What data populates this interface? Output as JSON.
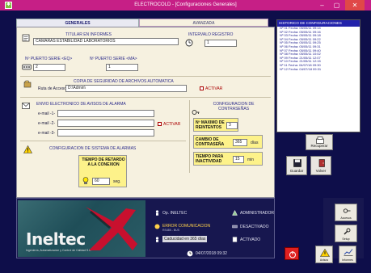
{
  "window": {
    "title": "ELECTROCOLD - [Configuraciones Generales]",
    "minimize": "–",
    "maximize": "▢",
    "close": "✕"
  },
  "tabs": [
    {
      "label": "GENERALES",
      "active": true
    },
    {
      "label": "AVANZADA",
      "active": false
    }
  ],
  "general": {
    "titular_label": "TITULAR EN INFORMES",
    "titular_value": "CAMARAS ESTABILIDAD LABORATORIOS",
    "intervalo_label": "INTERVALO REGISTRO",
    "intervalo_value": "1",
    "puerto_eq_label": "Nº PUERTO SERIE <EQ>",
    "puerto_eq_value": "2",
    "puerto_ma_label": "Nº PUERTO SERIE <MA>",
    "puerto_ma_value": "1",
    "backup_label": "COPIA DE SEGURIDAD DE ARCHIVOS AUTOMATICA",
    "ruta_label": "Ruta de Acceso",
    "ruta_value": "D:\\Admin\\",
    "backup_activar": "ACTIVAR"
  },
  "email": {
    "title": "ENVIO ELECTRONICO DE AVISOS DE ALARMA",
    "fields": [
      {
        "label": "e-mail -1-",
        "value": ""
      },
      {
        "label": "e-mail -2-",
        "value": ""
      },
      {
        "label": "e-mail -3-",
        "value": ""
      }
    ],
    "activar": "ACTIVAR"
  },
  "password": {
    "title": "CONFIGURACION DE CONTRASEÑAS",
    "max_reintentos_label": "Nº MAXIMO DE REINTENTOS",
    "max_reintentos_value": "3",
    "cambio_label": "CAMBIO DE CONTRASEÑA",
    "cambio_value": "365",
    "cambio_unit": "días",
    "tiempo_label": "TIEMPO PARA INACTIVIDAD",
    "tiempo_value": "15",
    "tiempo_unit": "min"
  },
  "alarm": {
    "title": "CONFIGURACION DE SISTEMA DE ALARMAS",
    "retardo_label": "TIEMPO DE RETARDO A LA CONEXION",
    "retardo_value": "60",
    "retardo_unit": "seg."
  },
  "history": {
    "title": "HISTORICO DE CONFIGURACIONES",
    "rows": [
      "Nº 01 Fecha: 05/05/11 09:14",
      "Nº 02 Fecha: 05/05/11 09:16",
      "Nº 03 Fecha: 05/05/11 09:18",
      "Nº 04 Fecha: 05/05/11 09:22",
      "Nº 05 Fecha: 05/05/11 09:25",
      "Nº 06 Fecha: 05/05/11 09:31",
      "Nº 07 Fecha: 05/05/11 09:40",
      "Nº 08 Fecha: 05/05/11 10:02",
      "Nº 09 Fecha: 21/05/11 12:07",
      "Nº 10 Fecha: 21/05/11 12:15",
      "Nº 11 Fecha: 04/07/18 09:30",
      "Nº 12 Fecha: 04/07/18 09:31"
    ]
  },
  "buttons": {
    "recuperar": "Recuperar",
    "guardar": "Guardar",
    "volver": "Volver"
  },
  "status": {
    "operator": "Op. INELTEC",
    "role": "ADMINISTRADOR",
    "error": "ERROR COMUNICACION",
    "error_sub": "RS485 - BUS",
    "desactivado": "DESACTIVADO",
    "caducidad": "Caducidad en 365 días",
    "activado": "ACTIVADO",
    "datetime": "04/07/2018 09:32"
  },
  "logo": {
    "name": "Ineltec",
    "tagline": "Ingeniería, Automatizacion y Control de Calidad S.L."
  },
  "sidebar": {
    "accesos": "Accesos",
    "setup": "Setup",
    "avisos": "Avisos",
    "informes": "Informes"
  },
  "colors": {
    "titlebar": "#c61f86",
    "window_bg": "#0e0e4a",
    "panel_bg": "#f6f1e0",
    "highlight_yellow": "#fdf28a",
    "error_yellow": "#ffd14a"
  }
}
